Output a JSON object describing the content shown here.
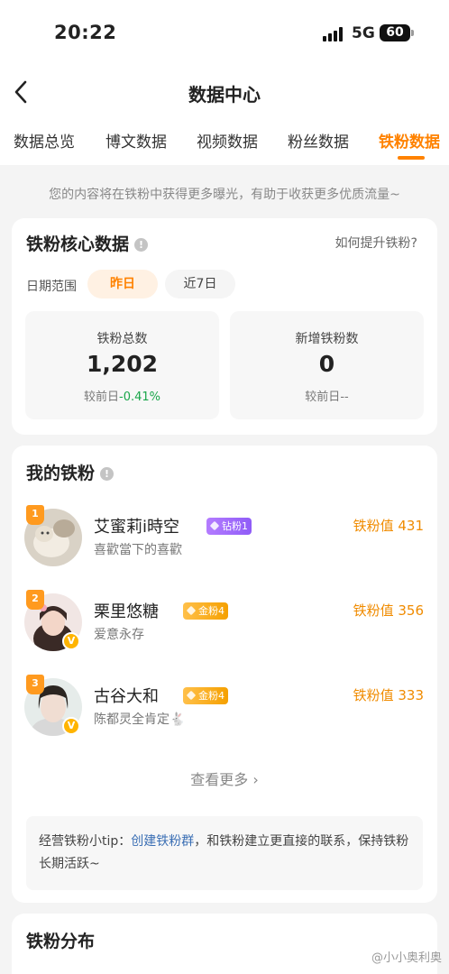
{
  "status": {
    "time": "20:22",
    "network": "5G",
    "battery": "60"
  },
  "nav": {
    "title": "数据中心"
  },
  "tabs": [
    {
      "label": "数据总览",
      "active": false
    },
    {
      "label": "博文数据",
      "active": false
    },
    {
      "label": "视频数据",
      "active": false
    },
    {
      "label": "粉丝数据",
      "active": false
    },
    {
      "label": "铁粉数据",
      "active": true
    }
  ],
  "notice": "您的内容将在铁粉中获得更多曝光，有助于收获更多优质流量~",
  "core": {
    "title": "铁粉核心数据",
    "howto": "如何提升铁粉?",
    "date_label": "日期范围",
    "ranges": [
      "昨日",
      "近7日"
    ],
    "stats": [
      {
        "label": "铁粉总数",
        "value": "1,202",
        "compare_prefix": "较前日",
        "compare_value": "-0.41%"
      },
      {
        "label": "新增铁粉数",
        "value": "0",
        "compare_prefix": "较前日",
        "compare_value": "--"
      }
    ]
  },
  "myfans": {
    "title": "我的铁粉",
    "items": [
      {
        "rank": "1",
        "name": "艾蜜莉i時空",
        "level": "钻粉1",
        "level_type": "diamond",
        "subtitle": "喜歡當下的喜歡",
        "score_label": "铁粉值",
        "score": "431",
        "verified": false
      },
      {
        "rank": "2",
        "name": "栗里悠糖",
        "level": "金粉4",
        "level_type": "gold",
        "subtitle": "爱意永存",
        "score_label": "铁粉值",
        "score": "356",
        "verified": true
      },
      {
        "rank": "3",
        "name": "古谷大和",
        "level": "金粉4",
        "level_type": "gold",
        "subtitle": "陈都灵全肯定🐇",
        "score_label": "铁粉值",
        "score": "333",
        "verified": true
      }
    ],
    "more": "查看更多",
    "tip_prefix": "经营铁粉小tip：",
    "tip_link": "创建铁粉群",
    "tip_suffix": "，和铁粉建立更直接的联系，保持铁粉长期活跃~",
    "verified_mark": "V"
  },
  "distribution": {
    "title": "铁粉分布"
  },
  "watermark": "@小小奥利奥"
}
